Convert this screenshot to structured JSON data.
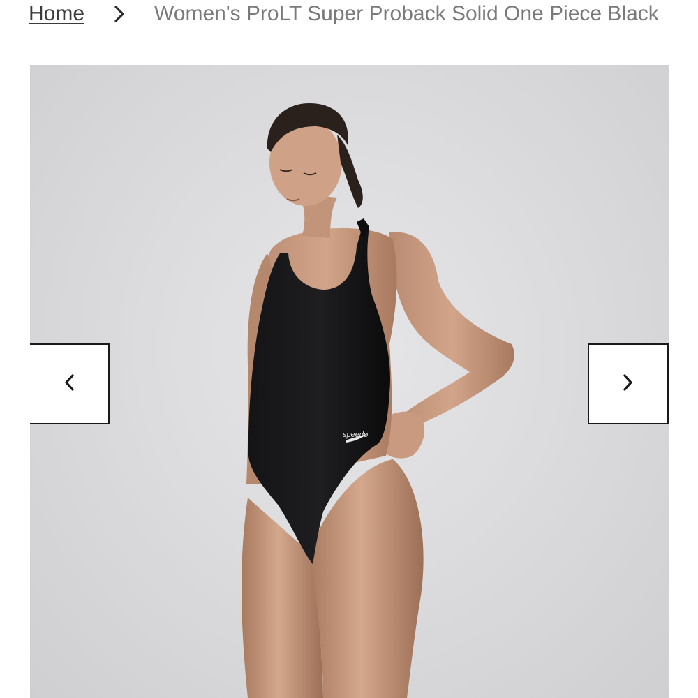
{
  "breadcrumb": {
    "home_label": "Home",
    "separator_icon": "chevron-right-icon",
    "current_label": "Women's ProLT Super Proback Solid One Piece Black"
  },
  "gallery": {
    "image_subject": "model-wearing-black-one-piece-swimsuit",
    "logo_text": "speedo",
    "prev_icon": "chevron-left-icon",
    "next_icon": "chevron-right-icon",
    "swimsuit_color": "#0d0d0f",
    "background_color": "#dcdcde"
  }
}
